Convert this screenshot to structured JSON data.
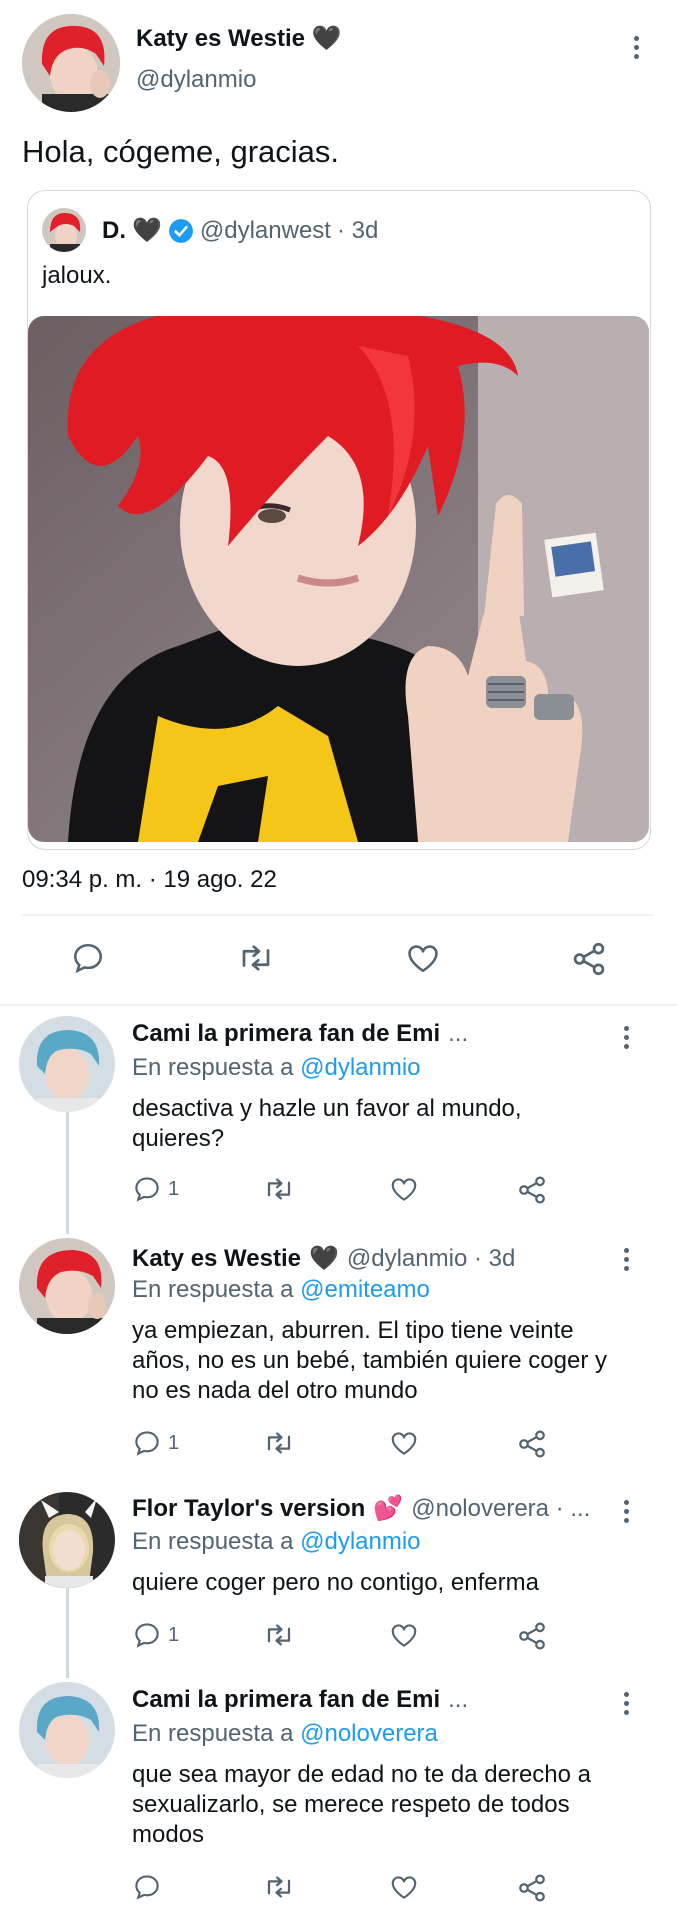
{
  "main_tweet": {
    "author_name": "Katy es Westie",
    "author_emoji": "🖤",
    "author_handle": "@dylanmio",
    "text": "Hola, cógeme, gracias.",
    "timestamp": "09:34 p. m. · 19 ago. 22"
  },
  "quoted_tweet": {
    "author_name": "D.",
    "author_emoji": "🖤",
    "author_handle": "@dylanwest",
    "age": "· 3d",
    "text": "jaloux."
  },
  "replies": [
    {
      "author_name": "Cami la primera fan de Emi",
      "author_handle": "...",
      "in_reply_prefix": "En respuesta a",
      "in_reply_to": "@dylanmio",
      "text": "desactiva y hazle un favor al mundo, quieres?",
      "reply_count": "1"
    },
    {
      "author_name": "Katy es Westie",
      "author_emoji": "🖤",
      "author_handle": "@dylanmio · 3d",
      "in_reply_prefix": "En respuesta a",
      "in_reply_to": "@emiteamo",
      "text": "ya empiezan, aburren. El tipo tiene veinte años, no es un bebé, también quiere coger y no es nada del otro mundo",
      "reply_count": "1"
    },
    {
      "author_name": "Flor Taylor's version",
      "author_emoji": "💕",
      "author_handle": "@noloverera · ...",
      "in_reply_prefix": "En respuesta a",
      "in_reply_to": "@dylanmio",
      "text": "quiere coger pero no contigo, enferma",
      "reply_count": "1"
    },
    {
      "author_name": "Cami la primera fan de Emi",
      "author_handle": "...",
      "in_reply_prefix": "En respuesta a",
      "in_reply_to": "@noloverera",
      "text": "que sea mayor de edad no te da derecho a sexualizarlo, se merece respeto de todos modos",
      "reply_count": ""
    }
  ],
  "colors": {
    "accent": "#1d9bf0",
    "text": "#0f1419",
    "secondary": "#536471",
    "divider": "#eff3f4",
    "hair_red": "#e0202a",
    "hair_blue": "#5aa8c8"
  },
  "icons": [
    "more-icon",
    "reply-icon",
    "retweet-icon",
    "like-icon",
    "share-icon",
    "verified-icon"
  ]
}
